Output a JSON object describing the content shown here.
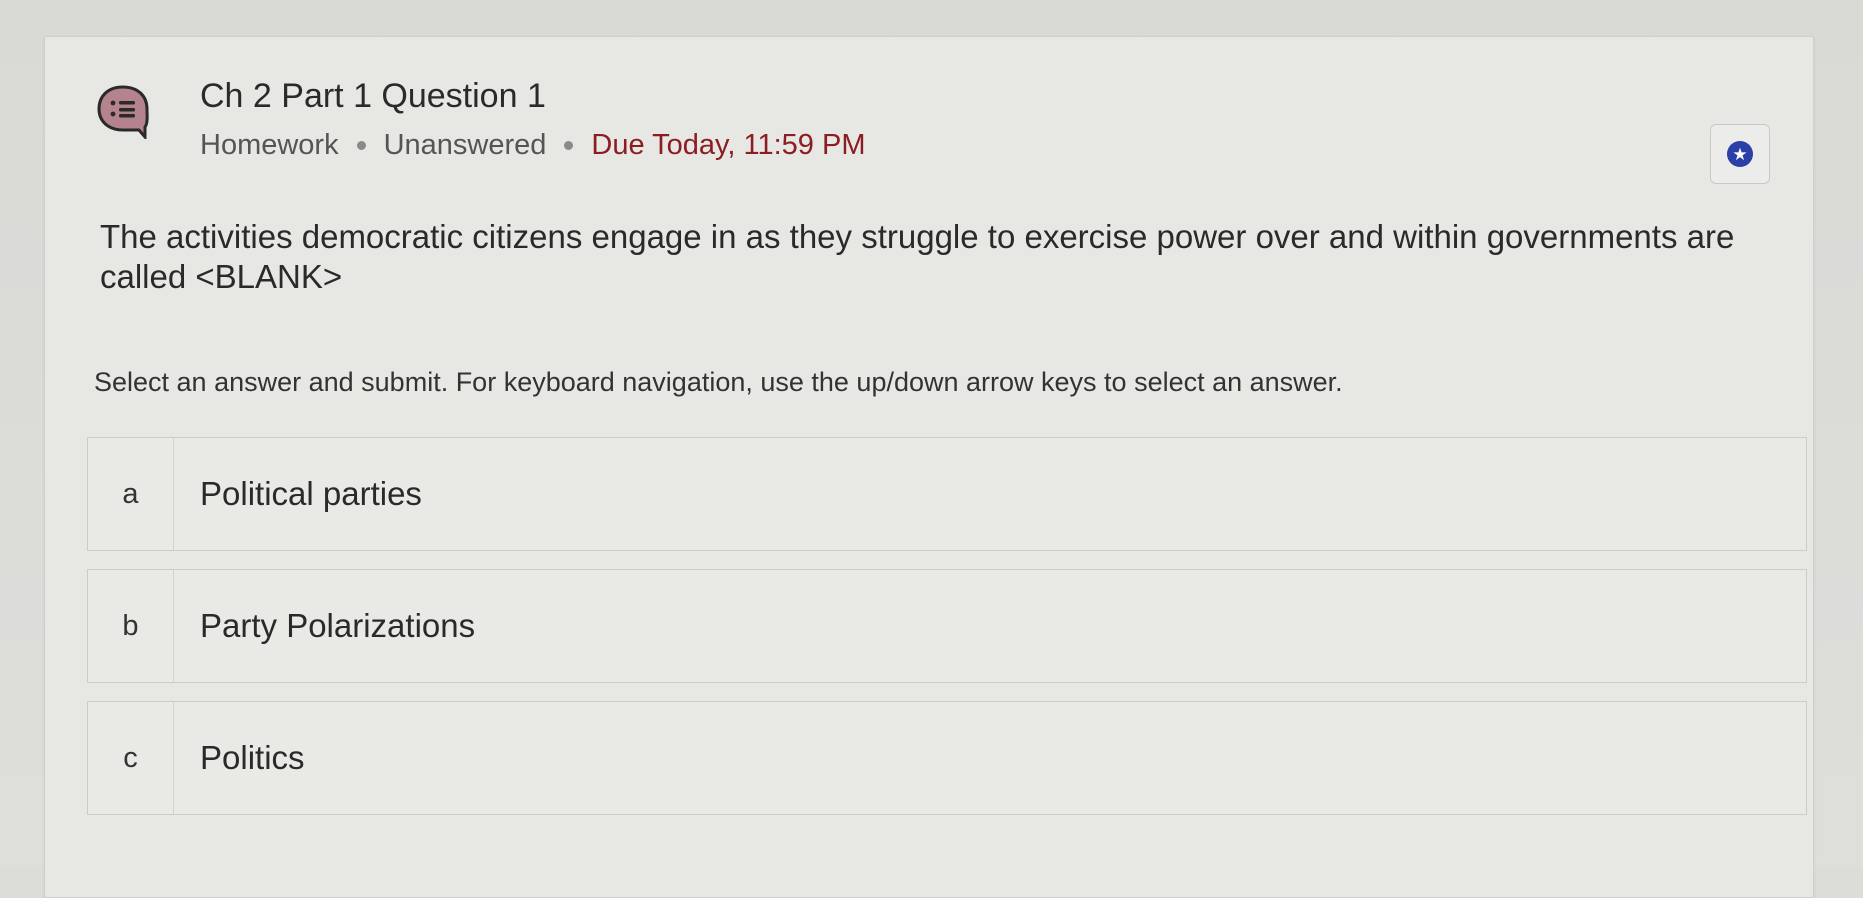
{
  "header": {
    "title": "Ch 2 Part 1 Question 1",
    "type": "Homework",
    "status": "Unanswered",
    "due": "Due Today, 11:59 PM",
    "icon": "question-list-icon",
    "star_icon": "star-icon"
  },
  "question": {
    "prompt": "The activities democratic citizens engage in as they struggle to exercise power over and within governments are called <BLANK>",
    "instructions": "Select an answer and submit. For keyboard navigation, use the up/down arrow keys to select an answer."
  },
  "options": [
    {
      "letter": "a",
      "text": "Political parties"
    },
    {
      "letter": "b",
      "text": "Party Polarizations"
    },
    {
      "letter": "c",
      "text": "Politics"
    }
  ],
  "colors": {
    "accent": "#2a3fa8",
    "due": "#8c1d22",
    "icon_bg": "#b5838e"
  }
}
